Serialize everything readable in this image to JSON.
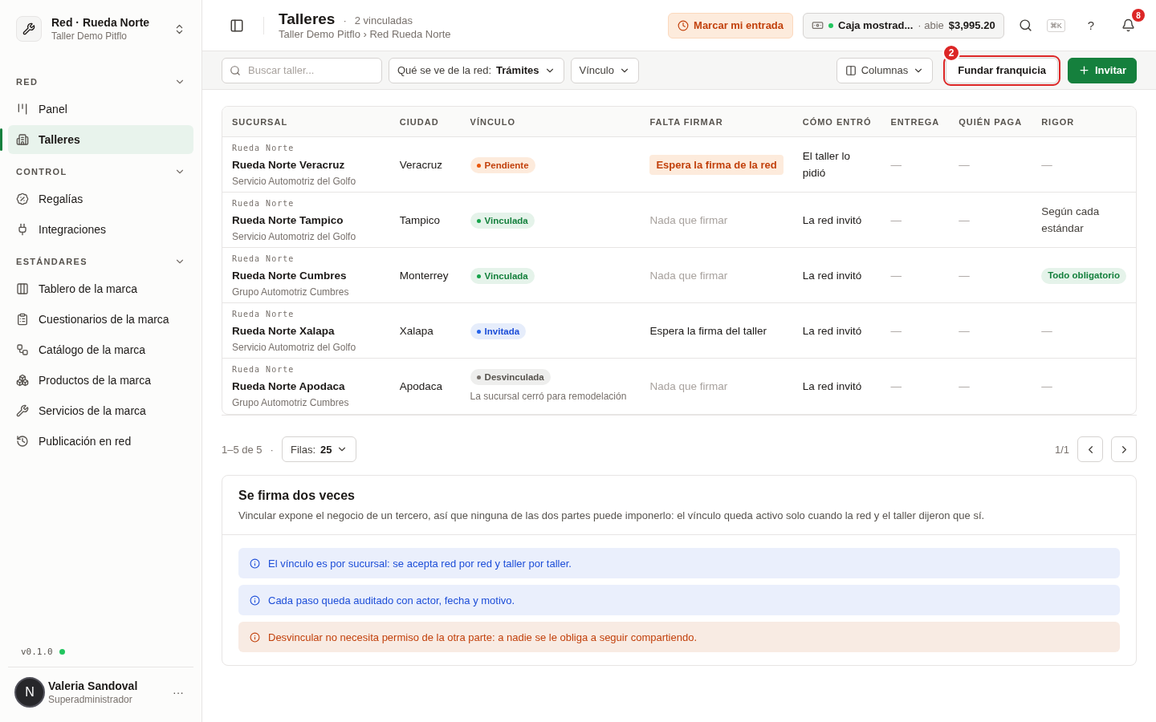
{
  "sidebar": {
    "org": {
      "title": "Red · Rueda Norte",
      "subtitle": "Taller Demo Pitflo"
    },
    "sections": [
      {
        "title": "RED",
        "expanded": true,
        "items": [
          {
            "label": "Panel",
            "selected": false
          },
          {
            "label": "Talleres",
            "selected": true
          }
        ]
      },
      {
        "title": "CONTROL",
        "expanded": true,
        "items": [
          {
            "label": "Regalías",
            "selected": false
          },
          {
            "label": "Integraciones",
            "selected": false
          }
        ]
      },
      {
        "title": "ESTÁNDARES",
        "expanded": true,
        "items": [
          {
            "label": "Tablero de la marca",
            "selected": false
          },
          {
            "label": "Cuestionarios de la marca",
            "selected": false
          },
          {
            "label": "Catálogo de la marca",
            "selected": false
          },
          {
            "label": "Productos de la marca",
            "selected": false
          },
          {
            "label": "Servicios de la marca",
            "selected": false
          },
          {
            "label": "Publicación en red",
            "selected": false
          }
        ]
      }
    ],
    "version": "v0.1.0",
    "user": {
      "initial": "N",
      "name": "Valeria Sandoval",
      "role": "Superadministrador",
      "menu": "···"
    }
  },
  "header": {
    "title": "Talleres",
    "count_sep": "·",
    "count": "2 vinculadas",
    "breadcrumb": "Taller Demo Pitflo › Red Rueda Norte",
    "clock_in": "Marcar mi entrada",
    "register": {
      "name": "Caja mostrad...",
      "sep": "·",
      "status": "abie",
      "amount": "$3,995.20"
    },
    "shortcut": "⌘K",
    "help": "?",
    "notifications": "8"
  },
  "toolbar": {
    "search": {
      "placeholder": "Buscar taller..."
    },
    "view": {
      "label": "Qué se ve de la red:",
      "value": "Trámites"
    },
    "link_filter": "Vínculo",
    "columns": "Columnas",
    "found": {
      "label": "Fundar franquicia",
      "annotation": "2"
    },
    "invite": "Invitar"
  },
  "table": {
    "columns": [
      "SUCURSAL",
      "CIUDAD",
      "VÍNCULO",
      "FALTA FIRMAR",
      "CÓMO ENTRÓ",
      "ENTREGA",
      "QUIÉN PAGA",
      "RIGOR"
    ],
    "rows": [
      {
        "network": "Rueda Norte",
        "name": "Rueda Norte Veracruz",
        "group": "Servicio Automotriz del Golfo",
        "city": "Veracruz",
        "link": {
          "kind": "pending",
          "label": "Pendiente"
        },
        "sign": {
          "kind": "badge",
          "text": "Espera la firma de la red"
        },
        "entry": "El taller lo pidió",
        "delivery": "—",
        "payer": "—",
        "rigor": {
          "kind": "plain",
          "text": "—"
        }
      },
      {
        "network": "Rueda Norte",
        "name": "Rueda Norte Tampico",
        "group": "Servicio Automotriz del Golfo",
        "city": "Tampico",
        "link": {
          "kind": "linked",
          "label": "Vinculada"
        },
        "sign": {
          "kind": "muted",
          "text": "Nada que firmar"
        },
        "entry": "La red invitó",
        "delivery": "—",
        "payer": "—",
        "rigor": {
          "kind": "plain",
          "text": "Según cada estándar"
        }
      },
      {
        "network": "Rueda Norte",
        "name": "Rueda Norte Cumbres",
        "group": "Grupo Automotriz Cumbres",
        "city": "Monterrey",
        "link": {
          "kind": "linked",
          "label": "Vinculada"
        },
        "sign": {
          "kind": "muted",
          "text": "Nada que firmar"
        },
        "entry": "La red invitó",
        "delivery": "—",
        "payer": "—",
        "rigor": {
          "kind": "badge",
          "text": "Todo obligatorio"
        }
      },
      {
        "network": "Rueda Norte",
        "name": "Rueda Norte Xalapa",
        "group": "Servicio Automotriz del Golfo",
        "city": "Xalapa",
        "link": {
          "kind": "invited",
          "label": "Invitada"
        },
        "sign": {
          "kind": "plain",
          "text": "Espera la firma del taller"
        },
        "entry": "La red invitó",
        "delivery": "—",
        "payer": "—",
        "rigor": {
          "kind": "plain",
          "text": "—"
        }
      },
      {
        "network": "Rueda Norte",
        "name": "Rueda Norte Apodaca",
        "group": "Grupo Automotriz Cumbres",
        "city": "Apodaca",
        "link": {
          "kind": "unlinked",
          "label": "Desvinculada",
          "note": "La sucursal cerró para remodelación"
        },
        "sign": {
          "kind": "muted",
          "text": "Nada que firmar"
        },
        "entry": "La red invitó",
        "delivery": "—",
        "payer": "—",
        "rigor": {
          "kind": "plain",
          "text": "—"
        }
      }
    ]
  },
  "pagination": {
    "range": "1–5 de 5",
    "sep": "·",
    "rows_label": "Filas:",
    "rows_value": "25",
    "page": "1/1"
  },
  "info": {
    "title": "Se firma dos veces",
    "text": "Vincular expone el negocio de un tercero, así que ninguna de las dos partes puede imponerlo: el vínculo queda activo solo cuando la red y el taller dijeron que sí.",
    "notes": [
      {
        "kind": "info",
        "text": "El vínculo es por sucursal: se acepta red por red y taller por taller."
      },
      {
        "kind": "info",
        "text": "Cada paso queda auditado con actor, fecha y motivo."
      },
      {
        "kind": "warning",
        "text": "Desvincular no necesita permiso de la otra parte: a nadie se le obliga a seguir compartiendo."
      }
    ]
  }
}
